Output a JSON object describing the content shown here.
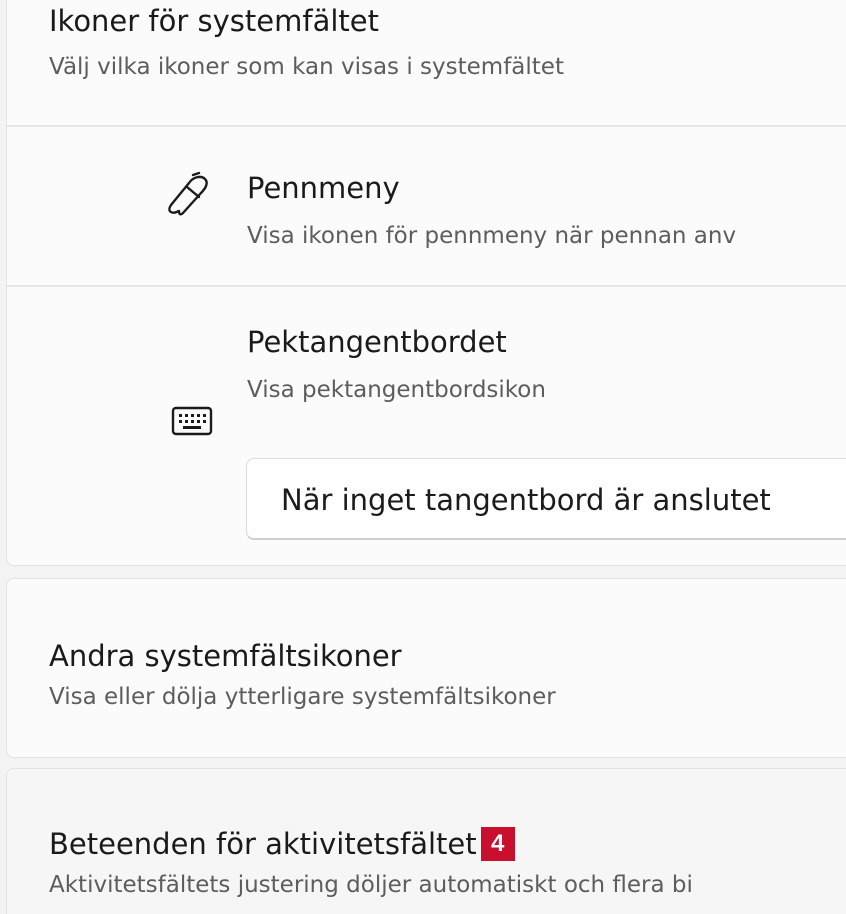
{
  "taskbar_icons": {
    "title": "Ikoner för systemfältet",
    "subtitle": "Välj vilka ikoner som kan visas i systemfältet",
    "items": [
      {
        "title": "Pennmeny",
        "subtitle": "Visa ikonen för pennmeny när pennan anv",
        "icon": "pen-icon"
      },
      {
        "title": "Pektangentbordet",
        "subtitle": "Visa pektangentbordsikon",
        "icon": "keyboard-icon",
        "dropdown_value": "När inget tangentbord är anslutet"
      }
    ]
  },
  "other_icons": {
    "title": "Andra systemfältsikoner",
    "subtitle": "Visa eller dölja ytterligare systemfältsikoner"
  },
  "behaviors": {
    "title": "Beteenden för aktivitetsfältet",
    "badge": "4",
    "subtitle": "Aktivitetsfältets justering döljer automatiskt och flera bi"
  },
  "colors": {
    "background": "#f3f3f3",
    "card": "#fbfbfb",
    "badge": "#c8102e",
    "text_primary": "#1a1a1a",
    "text_secondary": "#5d5d5d"
  }
}
